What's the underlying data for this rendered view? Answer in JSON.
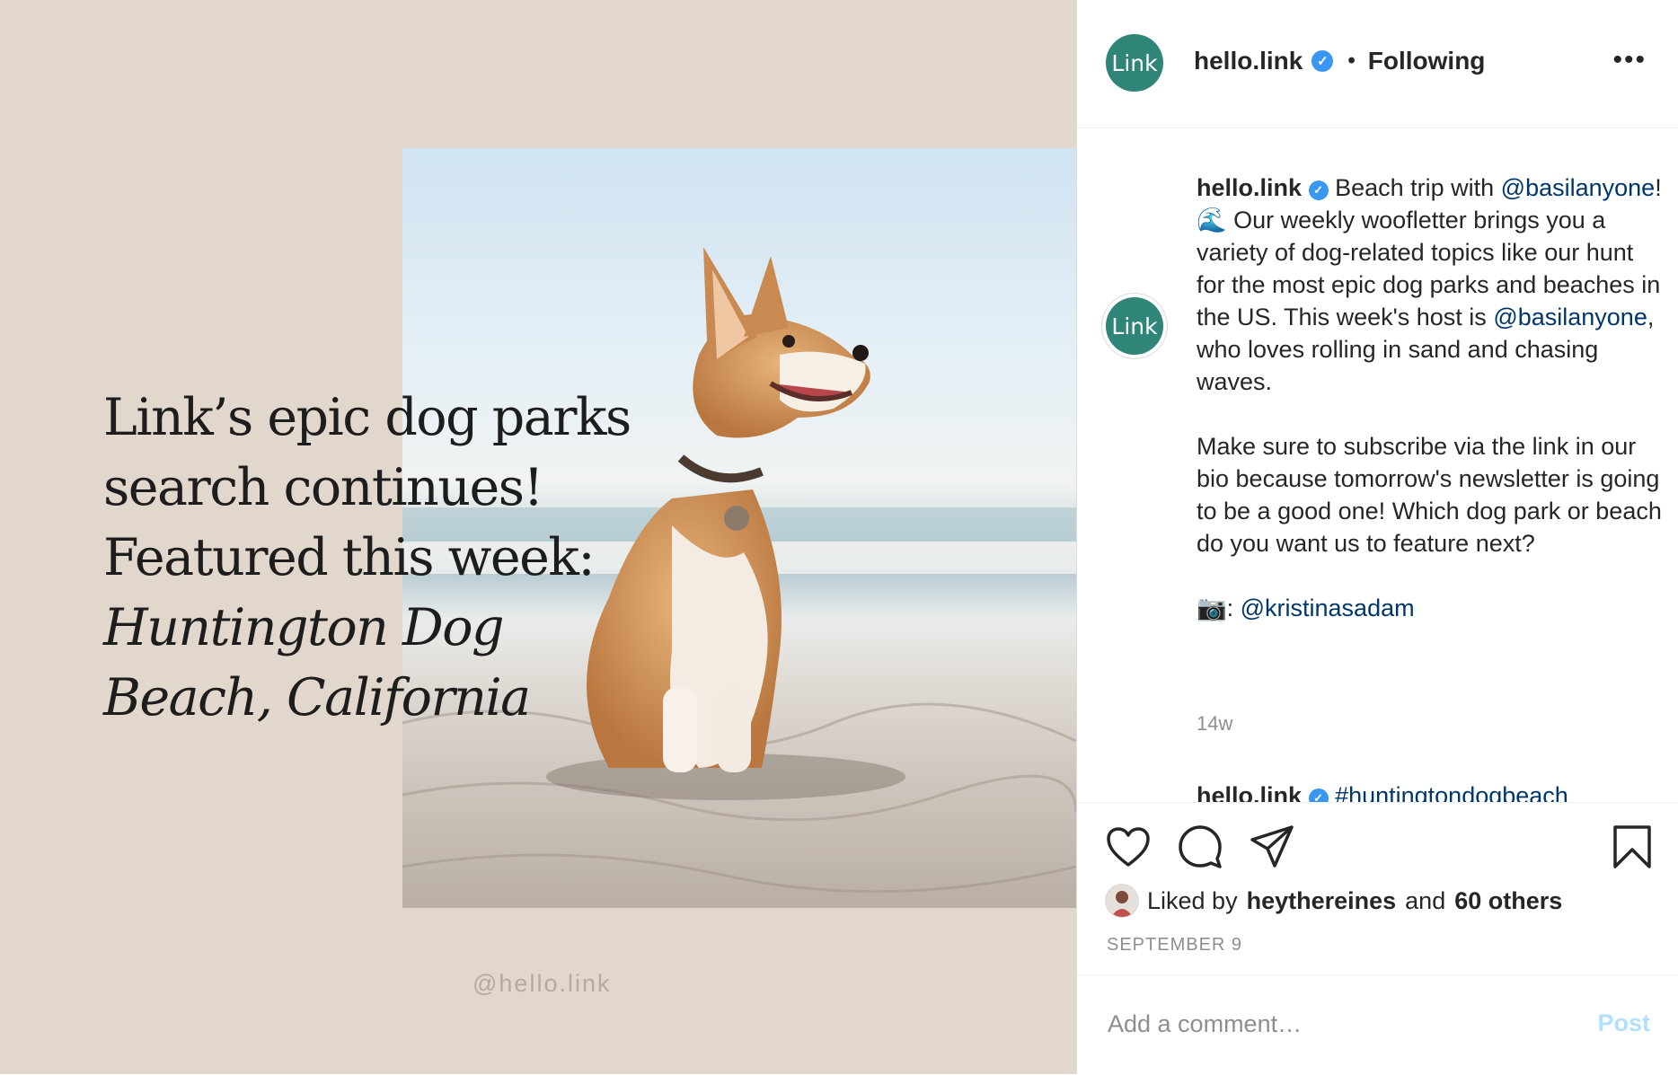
{
  "post_image": {
    "headline_lines": [
      "Link’s epic dog parks",
      "search continues!",
      "Featured this week:"
    ],
    "headline_italic_lines": [
      "Huntington Dog",
      "Beach, California"
    ],
    "watermark": "@hello.link"
  },
  "header": {
    "avatar_text": "Link",
    "username": "hello.link",
    "verified_icon": "verified-badge-icon",
    "follow_status": "Following",
    "more_icon": "ellipsis-icon"
  },
  "caption": {
    "username": "hello.link",
    "text_1": "Beach trip with",
    "mention_1": "@basilanyone",
    "text_2": "! 🌊 Our weekly woofletter brings you a variety of dog-related topics like our hunt for the most epic dog parks and beaches in the US. This week's host is",
    "mention_2": "@basilanyone",
    "text_3": ", who loves rolling in sand and chasing waves.",
    "paragraph_2": "Make sure to subscribe via the link in our bio because tomorrow's newsletter is going to be a good one! Which dog park or beach do you want us to feature next?",
    "credit_prefix": "📷: ",
    "credit_mention": "@kristinasadam",
    "age": "14w"
  },
  "next_comment": {
    "username": "hello.link",
    "hashtag": "#huntingtondogbeach"
  },
  "actions": {
    "like_icon": "heart-icon",
    "comment_icon": "comment-icon",
    "share_icon": "paper-plane-icon",
    "save_icon": "bookmark-icon"
  },
  "likes": {
    "prefix": "Liked by",
    "user": "heythereines",
    "conjunction": "and",
    "others": "60 others"
  },
  "date": "SEPTEMBER 9",
  "comment_box": {
    "placeholder": "Add a comment…",
    "post_label": "Post"
  },
  "colors": {
    "background_panel": "#e2d7cd",
    "avatar": "#2f8577",
    "verified": "#3897f0",
    "mention": "#00376b",
    "post_disabled": "#b2dffc"
  }
}
